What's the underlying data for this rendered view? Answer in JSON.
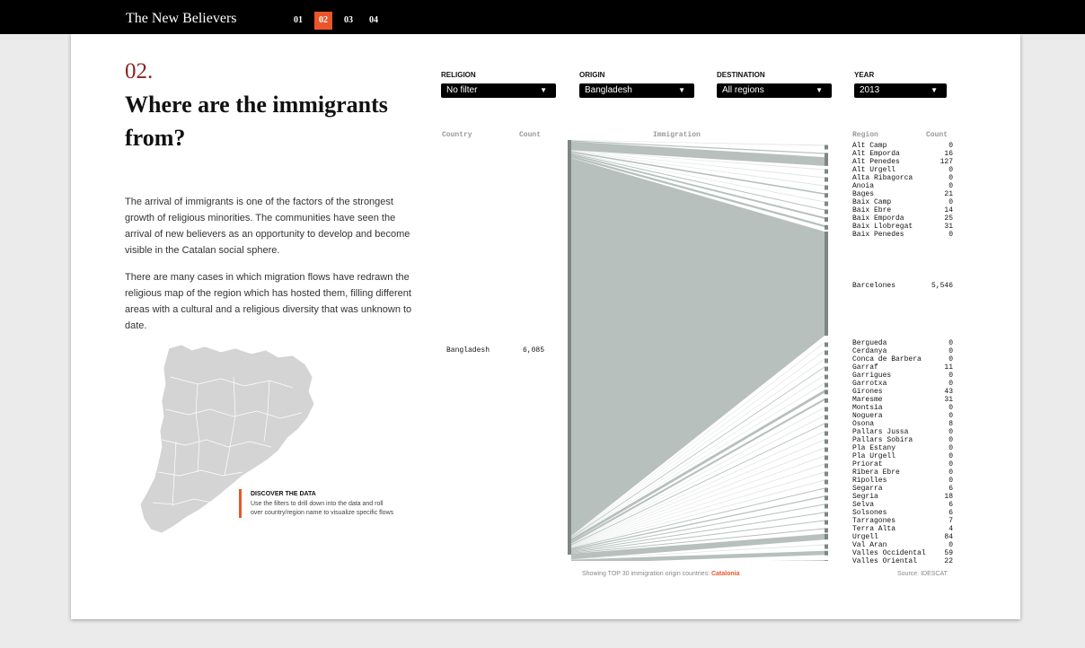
{
  "site": {
    "title": "The New Believers"
  },
  "nav": [
    {
      "label": "01",
      "active": false
    },
    {
      "label": "02",
      "active": true
    },
    {
      "label": "03",
      "active": false
    },
    {
      "label": "04",
      "active": false
    }
  ],
  "section": {
    "number": "02.",
    "title": "Where are the immigrants from?",
    "paragraphs": [
      "The arrival of immigrants is one of the factors of the strongest growth of religious minorities. The communities have seen the arrival of new believers as an opportunity to develop and become visible in the Catalan social sphere.",
      "There are many cases in which migration flows have redrawn the religious map of the region which has hosted them, filling different areas with a cultural and a religious diversity that was unknown to date."
    ]
  },
  "discover": {
    "title": "DISCOVER THE DATA",
    "text": "Use the filters to drill down into the data and roll over country/region name to visualize specific flows"
  },
  "filters": {
    "religion": {
      "label": "RELIGION",
      "value": "No filter"
    },
    "origin": {
      "label": "ORIGIN",
      "value": "Bangladesh"
    },
    "destination": {
      "label": "DESTINATION",
      "value": "All regions"
    },
    "year": {
      "label": "YEAR",
      "value": "2013"
    }
  },
  "columns": {
    "country": "Country",
    "count": "Count",
    "immigration": "Immigration",
    "region": "Region",
    "region_count": "Count"
  },
  "origin_row": {
    "country": "Bangladesh",
    "count": "6,085"
  },
  "regions": [
    {
      "name": "Alt Camp",
      "count": "0",
      "value": 0
    },
    {
      "name": "Alt Emporda",
      "count": "16",
      "value": 16
    },
    {
      "name": "Alt Penedes",
      "count": "127",
      "value": 127
    },
    {
      "name": "Alt Urgell",
      "count": "0",
      "value": 0
    },
    {
      "name": "Alta Ribagorca",
      "count": "0",
      "value": 0
    },
    {
      "name": "Anoia",
      "count": "0",
      "value": 0
    },
    {
      "name": "Bages",
      "count": "21",
      "value": 21
    },
    {
      "name": "Baix Camp",
      "count": "0",
      "value": 0
    },
    {
      "name": "Baix Ebre",
      "count": "14",
      "value": 14
    },
    {
      "name": "Baix Emporda",
      "count": "25",
      "value": 25
    },
    {
      "name": "Baix Llobregat",
      "count": "31",
      "value": 31
    },
    {
      "name": "Baix Penedes",
      "count": "0",
      "value": 0
    },
    {
      "name": "Barcelones",
      "count": "5,546",
      "value": 5546
    },
    {
      "name": "Bergueda",
      "count": "0",
      "value": 0
    },
    {
      "name": "Cerdanya",
      "count": "0",
      "value": 0
    },
    {
      "name": "Conca de Barbera",
      "count": "0",
      "value": 0
    },
    {
      "name": "Garraf",
      "count": "11",
      "value": 11
    },
    {
      "name": "Garrigues",
      "count": "0",
      "value": 0
    },
    {
      "name": "Garrotxa",
      "count": "0",
      "value": 0
    },
    {
      "name": "Girones",
      "count": "43",
      "value": 43
    },
    {
      "name": "Maresme",
      "count": "31",
      "value": 31
    },
    {
      "name": "Montsia",
      "count": "0",
      "value": 0
    },
    {
      "name": "Noguera",
      "count": "0",
      "value": 0
    },
    {
      "name": "Osona",
      "count": "8",
      "value": 8
    },
    {
      "name": "Pallars Jussa",
      "count": "0",
      "value": 0
    },
    {
      "name": "Pallars Sobira",
      "count": "0",
      "value": 0
    },
    {
      "name": "Pla Estany",
      "count": "0",
      "value": 0
    },
    {
      "name": "Pla Urgell",
      "count": "0",
      "value": 0
    },
    {
      "name": "Priorat",
      "count": "0",
      "value": 0
    },
    {
      "name": "Ribera Ebre",
      "count": "0",
      "value": 0
    },
    {
      "name": "Ripolles",
      "count": "0",
      "value": 0
    },
    {
      "name": "Segarra",
      "count": "6",
      "value": 6
    },
    {
      "name": "Segria",
      "count": "18",
      "value": 18
    },
    {
      "name": "Selva",
      "count": "6",
      "value": 6
    },
    {
      "name": "Solsones",
      "count": "6",
      "value": 6
    },
    {
      "name": "Tarragones",
      "count": "7",
      "value": 7
    },
    {
      "name": "Terra Alta",
      "count": "4",
      "value": 4
    },
    {
      "name": "Urgell",
      "count": "84",
      "value": 84
    },
    {
      "name": "Val Aran",
      "count": "0",
      "value": 0
    },
    {
      "name": "Valles Occidental",
      "count": "59",
      "value": 59
    },
    {
      "name": "Valles Oriental",
      "count": "22",
      "value": 22
    }
  ],
  "footer": {
    "showing": "Showing TOP 30 immigration origin countries:",
    "scope": "Catalonia",
    "source": "Source: IDESCAT"
  },
  "colors": {
    "accent": "#e8562a",
    "flow": "#b3bdb9",
    "bar": "#7d8784",
    "title_red": "#8b2323"
  },
  "chart_data": {
    "type": "flow",
    "source": "Bangladesh",
    "source_total": 6085,
    "targets": [
      {
        "name": "Alt Camp",
        "value": 0
      },
      {
        "name": "Alt Emporda",
        "value": 16
      },
      {
        "name": "Alt Penedes",
        "value": 127
      },
      {
        "name": "Alt Urgell",
        "value": 0
      },
      {
        "name": "Alta Ribagorca",
        "value": 0
      },
      {
        "name": "Anoia",
        "value": 0
      },
      {
        "name": "Bages",
        "value": 21
      },
      {
        "name": "Baix Camp",
        "value": 0
      },
      {
        "name": "Baix Ebre",
        "value": 14
      },
      {
        "name": "Baix Emporda",
        "value": 25
      },
      {
        "name": "Baix Llobregat",
        "value": 31
      },
      {
        "name": "Baix Penedes",
        "value": 0
      },
      {
        "name": "Barcelones",
        "value": 5546
      },
      {
        "name": "Bergueda",
        "value": 0
      },
      {
        "name": "Cerdanya",
        "value": 0
      },
      {
        "name": "Conca de Barbera",
        "value": 0
      },
      {
        "name": "Garraf",
        "value": 11
      },
      {
        "name": "Garrigues",
        "value": 0
      },
      {
        "name": "Garrotxa",
        "value": 0
      },
      {
        "name": "Girones",
        "value": 43
      },
      {
        "name": "Maresme",
        "value": 31
      },
      {
        "name": "Montsia",
        "value": 0
      },
      {
        "name": "Noguera",
        "value": 0
      },
      {
        "name": "Osona",
        "value": 8
      },
      {
        "name": "Pallars Jussa",
        "value": 0
      },
      {
        "name": "Pallars Sobira",
        "value": 0
      },
      {
        "name": "Pla Estany",
        "value": 0
      },
      {
        "name": "Pla Urgell",
        "value": 0
      },
      {
        "name": "Priorat",
        "value": 0
      },
      {
        "name": "Ribera Ebre",
        "value": 0
      },
      {
        "name": "Ripolles",
        "value": 0
      },
      {
        "name": "Segarra",
        "value": 6
      },
      {
        "name": "Segria",
        "value": 18
      },
      {
        "name": "Selva",
        "value": 6
      },
      {
        "name": "Solsones",
        "value": 6
      },
      {
        "name": "Tarragones",
        "value": 7
      },
      {
        "name": "Terra Alta",
        "value": 4
      },
      {
        "name": "Urgell",
        "value": 84
      },
      {
        "name": "Val Aran",
        "value": 0
      },
      {
        "name": "Valles Occidental",
        "value": 59
      },
      {
        "name": "Valles Oriental",
        "value": 22
      }
    ]
  }
}
